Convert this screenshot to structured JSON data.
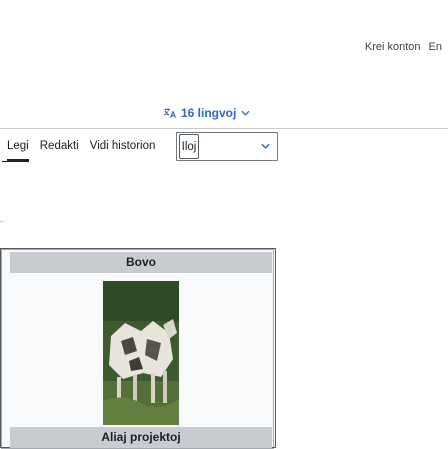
{
  "header": {
    "links": [
      "Krei konton",
      "En"
    ]
  },
  "language": {
    "label": "16 lingvoj",
    "icon": "translate-icon"
  },
  "tabs": [
    {
      "label": "Legi",
      "active": true
    },
    {
      "label": "Redakti",
      "active": false
    },
    {
      "label": "Vidi historion",
      "active": false
    }
  ],
  "tools": {
    "label": "Iloj"
  },
  "panel": {
    "title": "Bovo",
    "footer": "Aliaj projektoj"
  },
  "colors": {
    "link": "#3366cc",
    "panel_bg": "#c8ccd1"
  }
}
